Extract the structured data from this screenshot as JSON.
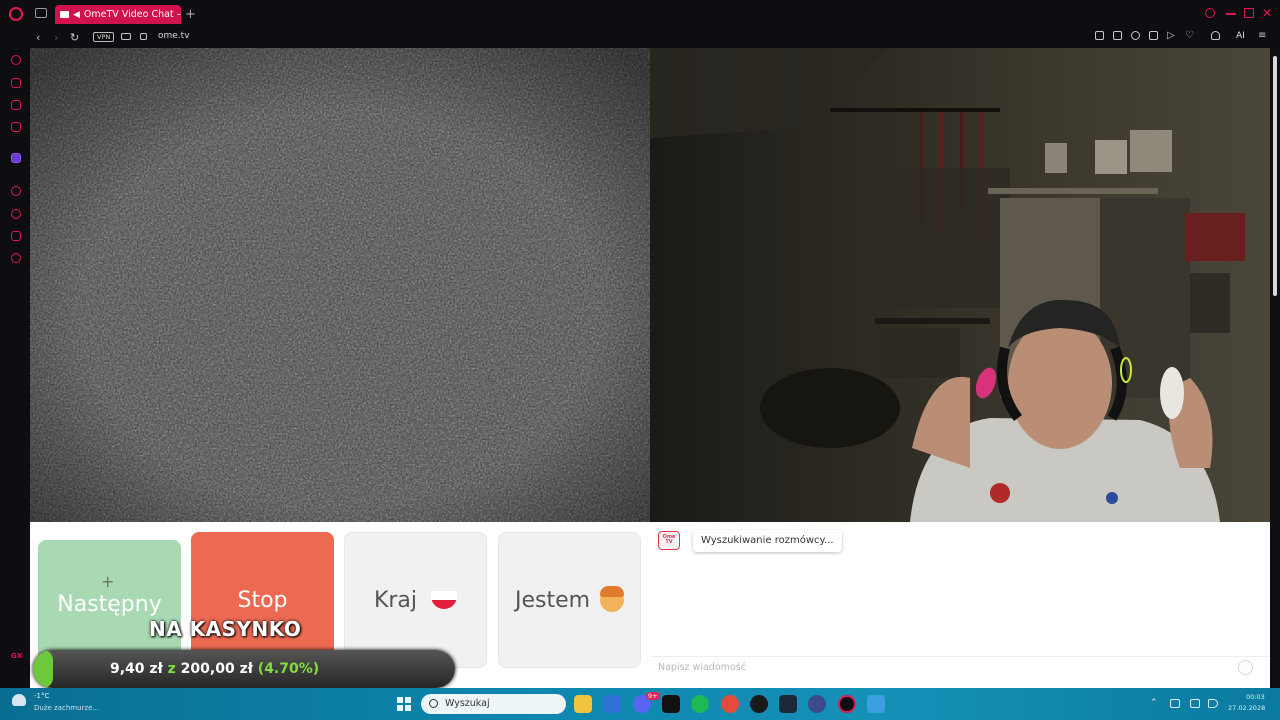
{
  "browser": {
    "tab_title": "OmeTV Video Chat — ",
    "new_tab_symbol": "+",
    "url": "ome.tv",
    "vpn_badge": "VPN",
    "ai_label": "AI",
    "back_symbol": "‹",
    "forward_symbol": "›",
    "reload_symbol": "↻"
  },
  "sidebar": {
    "gx_label": "GX",
    "icons": [
      "history-icon",
      "bag-icon",
      "messenger-icon",
      "news-icon",
      "twitch-icon",
      "player-icon",
      "clock-icon",
      "extensions-icon",
      "settings-icon"
    ]
  },
  "controls": {
    "next_label": "Następny",
    "stop_label": "Stop",
    "country_label": "Kraj",
    "iam_label": "Jestem",
    "plus_symbol": "+"
  },
  "chat": {
    "status_message": "Wyszukiwanie rozmówcy...",
    "input_placeholder": "Napisz wiadomość",
    "logo_text": "Ome TV"
  },
  "overlay": {
    "headline": "NA KASYNKO",
    "current": "9,40 zł",
    "separator": "z",
    "goal": "200,00 zł",
    "percent_text": "(4.70%)",
    "progress_fraction": 0.047,
    "fill_color": "#6dc93b"
  },
  "taskbar": {
    "weather_temp": "-1°C",
    "weather_desc": "Duże zachmurze...",
    "search_placeholder": "Wyszukaj",
    "time": "00:03",
    "date": "27.02.2028",
    "discord_badge": "9+"
  },
  "colors": {
    "accent": "#e8174f",
    "stop": "#ec6a52",
    "next": "#a8d9b3"
  }
}
